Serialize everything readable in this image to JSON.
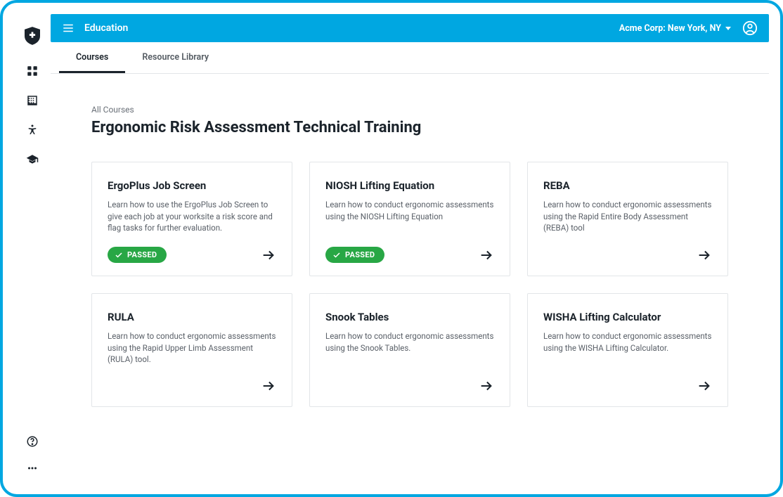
{
  "topbar": {
    "title": "Education",
    "org": "Acme Corp: New York, NY"
  },
  "tabs": {
    "courses": "Courses",
    "resource_library": "Resource Library"
  },
  "breadcrumb": "All Courses",
  "page_title": "Ergonomic Risk Assessment Technical Training",
  "passed_label": "PASSED",
  "courses": [
    {
      "title": "ErgoPlus Job Screen",
      "desc": "Learn how to use the ErgoPlus Job Screen to give each job at your worksite a risk score and flag tasks for further evaluation.",
      "passed": true
    },
    {
      "title": "NIOSH Lifting Equation",
      "desc": "Learn how to conduct ergonomic assessments using the NIOSH Lifting Equation",
      "passed": true
    },
    {
      "title": "REBA",
      "desc": "Learn how to conduct ergonomic assessments using the Rapid Entire Body Assessment (REBA) tool",
      "passed": false
    },
    {
      "title": "RULA",
      "desc": "Learn how to conduct ergonomic assessments using the Rapid Upper Limb Assessment (RULA) tool.",
      "passed": false
    },
    {
      "title": "Snook Tables",
      "desc": "Learn how to conduct ergonomic assessments using the Snook Tables.",
      "passed": false
    },
    {
      "title": "WISHA Lifting Calculator",
      "desc": "Learn how to conduct ergonomic assessments using the WISHA Lifting Calculator.",
      "passed": false
    }
  ]
}
